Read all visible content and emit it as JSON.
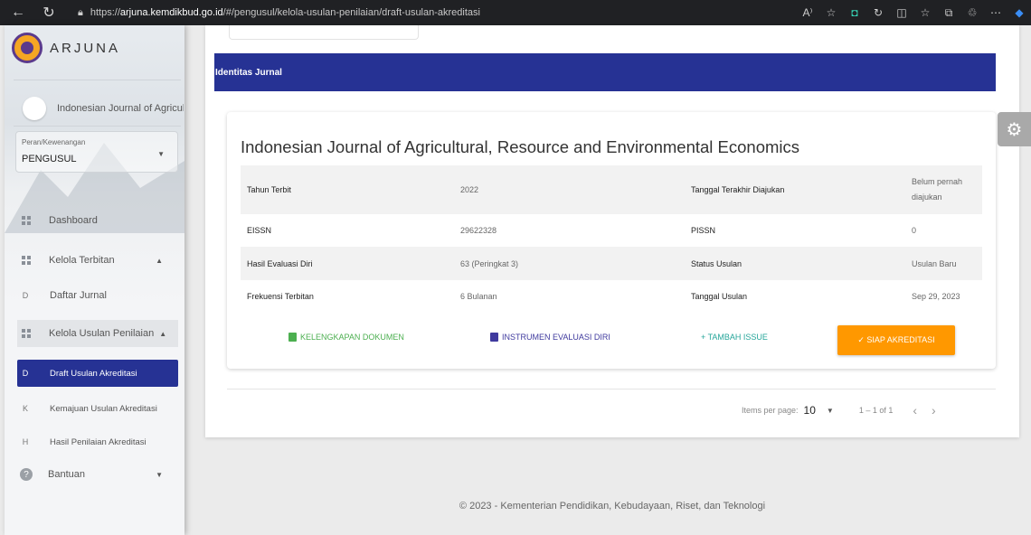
{
  "browser": {
    "url_prefix": "https://",
    "url_host": "arjuna.kemdikbud.go.id",
    "url_path": "/#/pengusul/kelola-usulan-penilaian/draft-usulan-akreditasi"
  },
  "sidebar": {
    "brand": "ARJUNA",
    "journal_selector": "Indonesian Journal of Agricultu",
    "role": {
      "label": "Peran/Kewenangan",
      "value": "PENGUSUL"
    },
    "menu": [
      {
        "label": "Dashboard",
        "icon": "grid-icon"
      },
      {
        "label": "Kelola Terbitan",
        "icon": "grid-icon"
      },
      {
        "label": "Daftar Jurnal",
        "letter": "D"
      },
      {
        "label": "Kelola Usulan Penilaian",
        "icon": "grid-icon"
      },
      {
        "label": "Draft Usulan Akreditasi",
        "letter": "D"
      },
      {
        "label": "Kemajuan Usulan Akreditasi",
        "letter": "K"
      },
      {
        "label": "Hasil Penilaian Akreditasi",
        "letter": "H"
      },
      {
        "label": "Bantuan",
        "icon": "help-icon"
      }
    ]
  },
  "main": {
    "section_title": "Identitas Jurnal",
    "journal_title": "Indonesian Journal of Agricultural, Resource and Environmental Economics",
    "rows": [
      {
        "l1": "Tahun Terbit",
        "v1": "2022",
        "l2": "Tanggal Terakhir Diajukan",
        "v2a": "Belum pernah",
        "v2b": "diajukan"
      },
      {
        "l1": "EISSN",
        "v1": "29622328",
        "l2": "PISSN",
        "v2a": "0"
      },
      {
        "l1": "Hasil Evaluasi Diri",
        "v1": "63 (Peringkat 3)",
        "l2": "Status Usulan",
        "v2a": "Usulan Baru"
      },
      {
        "l1": "Frekuensi Terbitan",
        "v1": "6 Bulanan",
        "l2": "Tanggal Usulan",
        "v2a": "Sep 29, 2023"
      }
    ],
    "actions": {
      "kelengkapan": "KELENGKAPAN DOKUMEN",
      "instrumen": "INSTRUMEN EVALUASI DIRI",
      "tambah": "+ TAMBAH ISSUE",
      "siap": "✓ SIAP AKREDITASI"
    },
    "paginator": {
      "label": "Items per page:",
      "size": "10",
      "range": "1 – 1 of 1"
    }
  },
  "footer": "© 2023 - Kementerian Pendidikan, Kebudayaan, Riset, dan Teknologi"
}
